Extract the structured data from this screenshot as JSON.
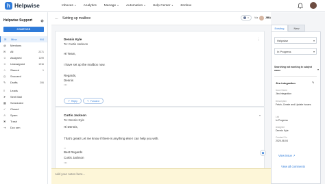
{
  "brand": {
    "name": "Helpwise",
    "accent": "#2f7bd9"
  },
  "nav": [
    {
      "label": "Inboxes",
      "caret": true
    },
    {
      "label": "Analytics",
      "caret": false
    },
    {
      "label": "Manage",
      "caret": true
    },
    {
      "label": "Automation",
      "caret": true
    },
    {
      "label": "Help Center",
      "caret": true
    },
    {
      "label": "Zenbox",
      "caret": false
    }
  ],
  "sidebar": {
    "mailbox_name": "Helpwise Support",
    "compose_label": "COMPOSE",
    "items": [
      {
        "label": "Mine",
        "count": "904",
        "icon": "inbox-icon",
        "active": true
      },
      {
        "label": "Mentions",
        "count": "",
        "icon": "at-icon"
      },
      {
        "label": "All",
        "count": "2271",
        "icon": "mail-icon"
      },
      {
        "label": "Assigned",
        "count": "1199",
        "icon": "user-check-icon"
      },
      {
        "label": "Unassigned",
        "count": "1916",
        "icon": "user-x-icon"
      },
      {
        "label": "Starred",
        "count": "1",
        "icon": "star-icon"
      },
      {
        "label": "Snoozed",
        "count": "",
        "icon": "clock-icon"
      },
      {
        "label": "Drafts",
        "count": "206",
        "icon": "draft-icon"
      },
      {
        "label": "Leads",
        "count": "",
        "icon": "leads-icon"
      },
      {
        "label": "Sent Mail",
        "count": "",
        "icon": "send-icon"
      },
      {
        "label": "Scheduled",
        "count": "",
        "icon": "calendar-icon"
      },
      {
        "label": "Closed",
        "count": "",
        "icon": "check-icon"
      },
      {
        "label": "Spam",
        "count": "",
        "icon": "spam-icon"
      },
      {
        "label": "Trash",
        "count": "",
        "icon": "trash-icon"
      },
      {
        "label": "Dcc sen",
        "count": "",
        "icon": "outbox-icon"
      }
    ]
  },
  "thread": {
    "subject": "Setting up mailbox",
    "assign_label": "Via",
    "assignee": "JIBA",
    "messages": [
      {
        "from": "Dennis Kyle",
        "to": "To: Curtis Jackson",
        "lines": [
          "Hi Team,",
          "I have set up the mailbox now.",
          "Regards,",
          "Dennis"
        ],
        "reply_label": "Reply",
        "forward_label": "Forward"
      },
      {
        "from": "Curtis Jackson",
        "to": "To: Dennis Kyle",
        "lines": [
          "Hi Dennis,",
          "That's great! Let me know if there is anything else I can help you with.",
          "--",
          "Best Regards",
          "Curtis Jackson"
        ]
      }
    ],
    "assign_event": "Curtis Jackson assigned the conversation to themselves",
    "notes_placeholder": "Add your notes here..."
  },
  "panel": {
    "tabs": [
      "Existing",
      "New"
    ],
    "project_select": "Helpwise",
    "status_select": "In Progress",
    "search_hint": "Searching not working in subject name",
    "issue_title": "Jira integration",
    "fields": [
      {
        "label": "Issue Name",
        "value": "Jira Integration"
      },
      {
        "label": "Description",
        "value": "Fetch, Create and Update Issues."
      },
      {
        "label": "List",
        "value": "In Progress"
      },
      {
        "label": "Assignee",
        "value": "Dennis Kyle"
      },
      {
        "label": "Created On",
        "value": "2020-08-04"
      }
    ],
    "view_issue": "View issue",
    "view_all": "View all comments"
  }
}
